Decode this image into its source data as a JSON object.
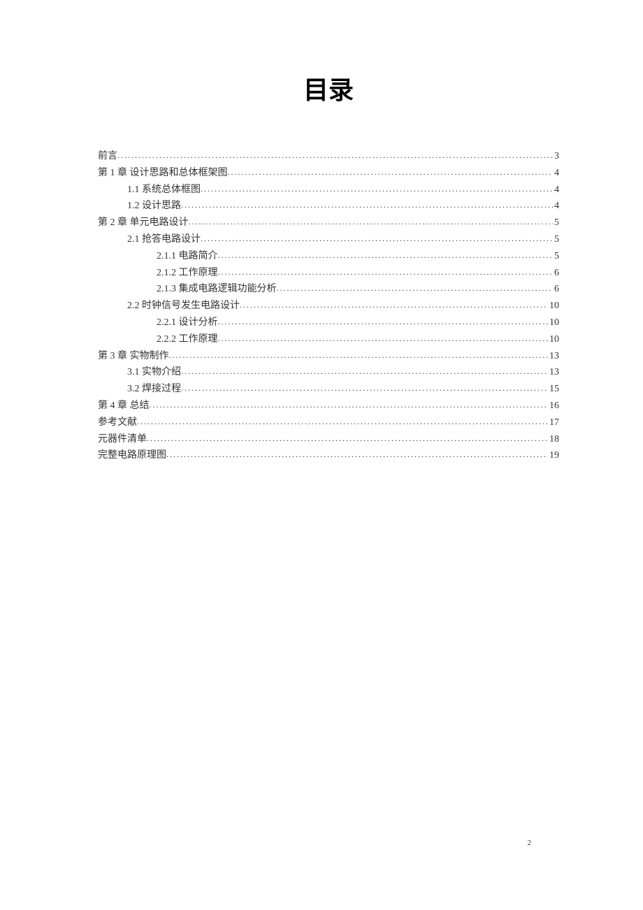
{
  "title": "目录",
  "page_number": "2",
  "toc": [
    {
      "label": "前言",
      "page": "3",
      "indent": 0
    },
    {
      "label": "第 1 章  设计思路和总体框架图",
      "page": "4",
      "indent": 0
    },
    {
      "label": "1.1  系统总体框图",
      "page": "4",
      "indent": 1
    },
    {
      "label": "1.2  设计思路",
      "page": "4",
      "indent": 1
    },
    {
      "label": "第 2 章  单元电路设计",
      "page": "5",
      "indent": 0
    },
    {
      "label": "2.1 抢答电路设计",
      "page": "5",
      "indent": 1
    },
    {
      "label": "2.1.1 电路简介",
      "page": "5",
      "indent": 2
    },
    {
      "label": "2.1.2 工作原理",
      "page": "6",
      "indent": 2
    },
    {
      "label": "2.1.3 集成电路逻辑功能分析",
      "page": "6",
      "indent": 2
    },
    {
      "label": "2.2 时钟信号发生电路设计",
      "page": "10",
      "indent": 1
    },
    {
      "label": "2.2.1  设计分析",
      "page": "10",
      "indent": 2
    },
    {
      "label": "2.2.2  工作原理",
      "page": "10",
      "indent": 2
    },
    {
      "label": "第 3 章  实物制作",
      "page": "13",
      "indent": 0
    },
    {
      "label": "3.1 实物介绍",
      "page": "13",
      "indent": 1
    },
    {
      "label": "3.2  焊接过程",
      "page": "15",
      "indent": 1
    },
    {
      "label": "第 4 章  总结",
      "page": "16",
      "indent": 0
    },
    {
      "label": "参考文献",
      "page": "17",
      "indent": 0
    },
    {
      "label": "元器件清单",
      "page": "18",
      "indent": 0
    },
    {
      "label": "完整电路原理图",
      "page": "19",
      "indent": 0
    }
  ]
}
